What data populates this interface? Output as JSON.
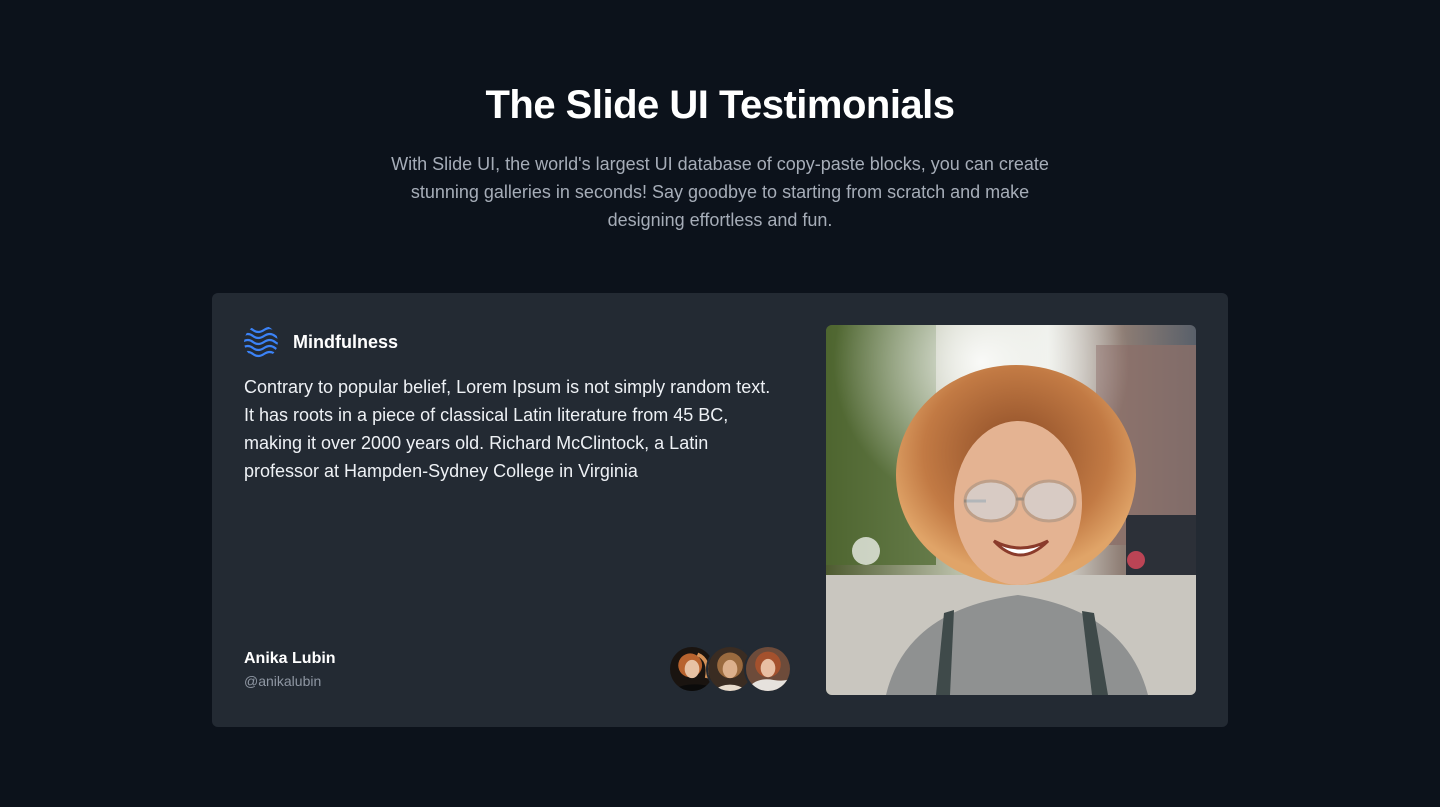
{
  "header": {
    "title": "The Slide UI Testimonials",
    "subtitle": "With Slide UI, the world's largest UI database of copy-paste blocks, you can create stunning galleries in seconds! Say goodbye to starting from scratch and make designing effortless and fun."
  },
  "testimonial": {
    "brand": {
      "name": "Mindfulness",
      "icon": "waves-logo-icon"
    },
    "quote": "Contrary to popular belief, Lorem Ipsum is not simply random text. It has roots in a piece of classical Latin literature from 45 BC, making it over 2000 years old. Richard McClintock, a Latin professor at Hampden-Sydney College in Virginia",
    "author": {
      "name": "Anika Lubin",
      "handle": "@anikalubin"
    },
    "avatars": [
      "avatar-1",
      "avatar-2",
      "avatar-3"
    ],
    "photo": "smiling-woman-photo"
  },
  "colors": {
    "background": "#0c121b",
    "card": "#232a33",
    "accent": "#3b82f6",
    "muted_text": "#a6adb8"
  }
}
